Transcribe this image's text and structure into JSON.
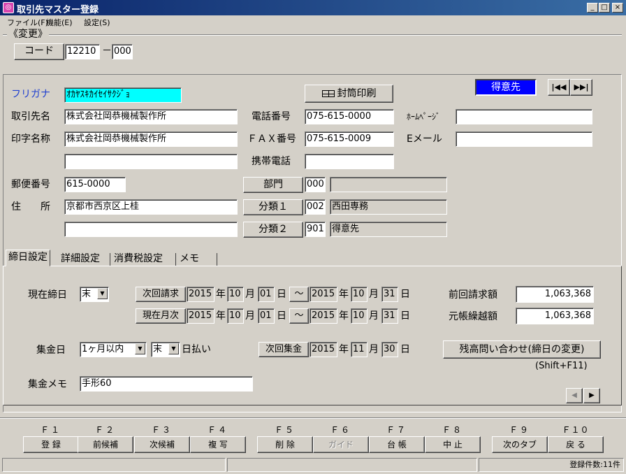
{
  "window": {
    "title": "取引先マスター登録",
    "min": "_",
    "max": "□",
    "close": "×"
  },
  "menu": [
    "ファイル(F)",
    "機能(E)",
    "設定(S)"
  ],
  "mode": "《変更》",
  "code": {
    "label": "コード",
    "main": "12210",
    "dash": "－",
    "sub": "000"
  },
  "furigana": {
    "label": "フリガナ",
    "value": "ｵｶﾔｽｷｶｲｾｲｻｸｼﾞｮ"
  },
  "envelope_button": "封筒印刷",
  "customer_type": "得意先",
  "name": {
    "label": "取引先名",
    "value": "株式会社岡恭機械製作所"
  },
  "print_name": {
    "label": "印字名称",
    "value": "株式会社岡恭機械製作所",
    "value2": ""
  },
  "phone": {
    "label": "電話番号",
    "value": "075-615-0000"
  },
  "fax": {
    "label": "ＦＡＸ番号",
    "value": "075-615-0009"
  },
  "mobile": {
    "label": "携帯電話",
    "value": ""
  },
  "homepage": {
    "label": "ﾎｰﾑﾍﾟｰｼﾞ",
    "value": ""
  },
  "email": {
    "label": "Eメール",
    "value": ""
  },
  "postal": {
    "label": "郵便番号",
    "value": "615-0000"
  },
  "address": {
    "label": "住　　所",
    "value": "京都市西京区上桂",
    "value2": ""
  },
  "department": {
    "label": "部門",
    "code": "000",
    "name": ""
  },
  "class1": {
    "label": "分類１",
    "code": "002",
    "name": "西田専務"
  },
  "class2": {
    "label": "分類２",
    "code": "901",
    "name": "得意先"
  },
  "tabs": [
    "締日設定",
    "詳細設定",
    "消費税設定",
    "メモ"
  ],
  "closing": {
    "label": "現在締日",
    "day": "末",
    "next_billing_label": "次回請求",
    "current_month_label": "現在月次",
    "nb_from": {
      "y": "2015",
      "m": "10",
      "d": "01"
    },
    "nb_to": {
      "y": "2015",
      "m": "10",
      "d": "31"
    },
    "cm_from": {
      "y": "2015",
      "m": "10",
      "d": "01"
    },
    "cm_to": {
      "y": "2015",
      "m": "10",
      "d": "31"
    },
    "year_unit": "年",
    "month_unit": "月",
    "day_unit": "日",
    "tilde": "～",
    "prev_billing_label": "前回請求額",
    "prev_billing": "1,063,368",
    "carryover_label": "元帳繰越額",
    "carryover": "1,063,368",
    "collection_label": "集金日",
    "collection_period": "1ヶ月以内",
    "collection_day": "末",
    "pay_suffix": "日払い",
    "next_collection_label": "次回集金",
    "nc": {
      "y": "2015",
      "m": "11",
      "d": "30"
    },
    "balance_button": "残高問い合わせ(締日の変更)",
    "shortcut": "(Shift+F11)",
    "memo_label": "集金メモ",
    "memo": "手形60"
  },
  "fkeys": [
    {
      "key": "Ｆ１",
      "label": "登 録"
    },
    {
      "key": "Ｆ２",
      "label": "前候補"
    },
    {
      "key": "Ｆ３",
      "label": "次候補"
    },
    {
      "key": "Ｆ４",
      "label": "複 写"
    },
    {
      "key": "Ｆ５",
      "label": "削 除"
    },
    {
      "key": "Ｆ６",
      "label": "ガイド"
    },
    {
      "key": "Ｆ７",
      "label": "台 帳"
    },
    {
      "key": "Ｆ８",
      "label": "中 止"
    },
    {
      "key": "Ｆ９",
      "label": "次のタブ"
    },
    {
      "key": "Ｆ１０",
      "label": "戻 る"
    }
  ],
  "status": {
    "count": "登録件数:11件"
  }
}
